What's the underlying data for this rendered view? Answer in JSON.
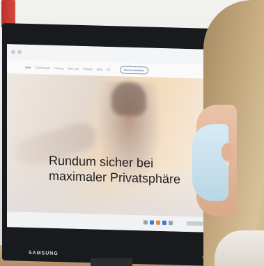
{
  "browser": {
    "nav_items": [
      {
        "label": "Start",
        "active": true
      },
      {
        "label": "Technologie"
      },
      {
        "label": "Lösung"
      },
      {
        "label": "Über uns"
      },
      {
        "label": "Kontakt"
      },
      {
        "label": "Blog"
      },
      {
        "label": "DE"
      }
    ],
    "contact_button": "Demo anfordern"
  },
  "hero": {
    "headline_line1": "Rundum sicher bei",
    "headline_line2": "maximaler Privatsphäre"
  },
  "monitor": {
    "brand": "SAMSUNG"
  },
  "colors": {
    "accent": "#3d5b8f",
    "mask": "#c8e1ee",
    "hair": "#c2a67b"
  },
  "icons": [
    "start-icon",
    "browser-icon",
    "folder-icon",
    "mail-icon",
    "settings-icon"
  ]
}
